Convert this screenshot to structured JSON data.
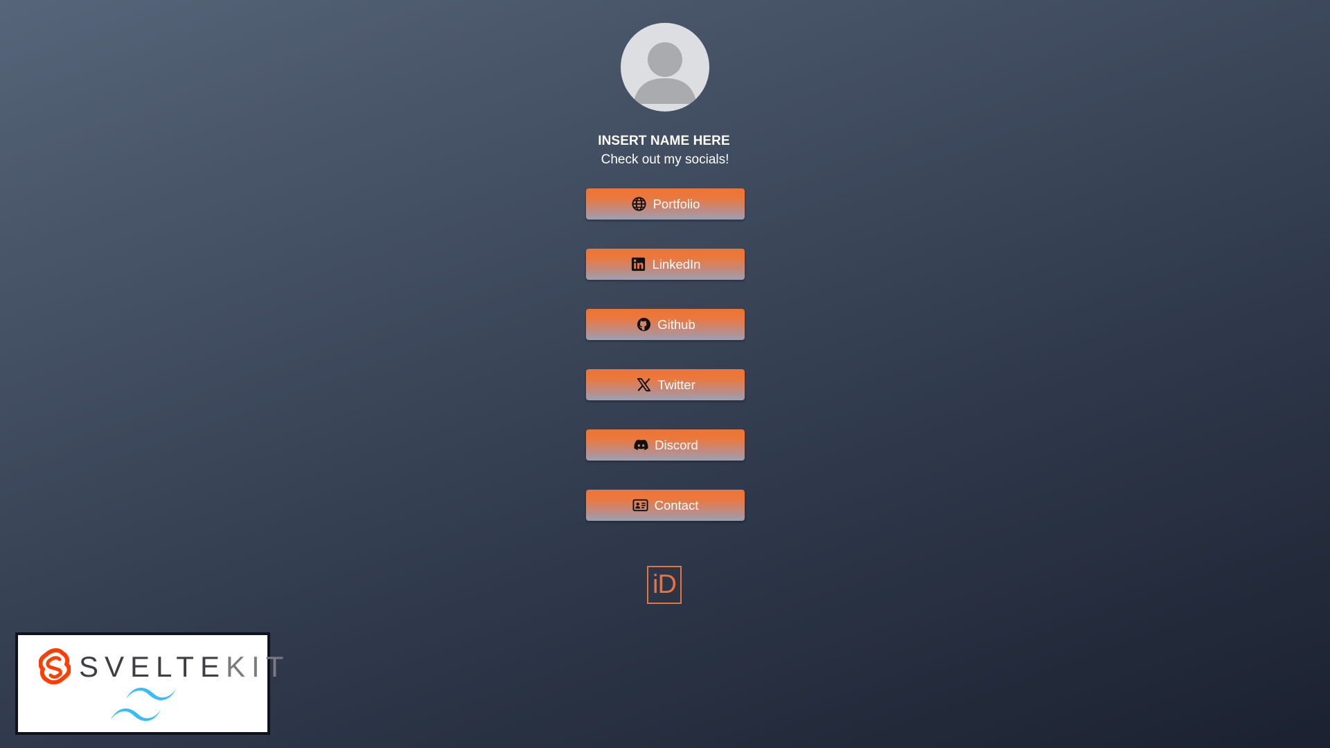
{
  "profile": {
    "name": "INSERT NAME HERE",
    "tagline": "Check out my socials!",
    "avatar_icon": "user-avatar-icon"
  },
  "links": [
    {
      "label": "Portfolio",
      "icon": "globe-icon"
    },
    {
      "label": "LinkedIn",
      "icon": "linkedin-icon"
    },
    {
      "label": "Github",
      "icon": "github-icon"
    },
    {
      "label": "Twitter",
      "icon": "x-twitter-icon"
    },
    {
      "label": "Discord",
      "icon": "discord-icon"
    },
    {
      "label": "Contact",
      "icon": "contact-card-icon"
    }
  ],
  "footer_logo": {
    "text": "iD"
  },
  "badge": {
    "word_part1": "SVELTE",
    "word_part2": "KIT"
  },
  "colors": {
    "accent_orange": "#e8733c",
    "button_bottom": "#9aa1b3",
    "background_top": "#566579",
    "background_bottom": "#1b2130",
    "svelte_orange": "#ff3e00",
    "tailwind_cyan": "#38bdf8"
  }
}
